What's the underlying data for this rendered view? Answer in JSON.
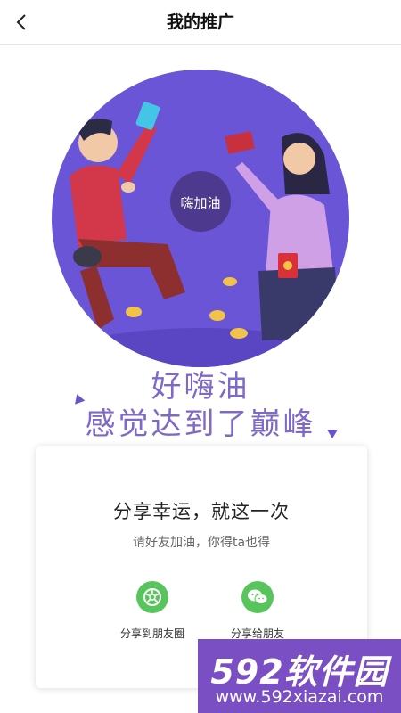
{
  "nav": {
    "back_icon": "chevron-left-icon",
    "title": "我的推广"
  },
  "hero": {
    "badge_text": "嗨加油",
    "slogan_line1": "好嗨油",
    "slogan_line2": "感觉达到了巅峰"
  },
  "share_card": {
    "title": "分享幸运，就这一次",
    "subtitle": "请好友加油，你得ta也得",
    "options": [
      {
        "label": "分享到朋友圈",
        "icon": "wechat-moments-icon"
      },
      {
        "label": "分享给朋友",
        "icon": "wechat-icon"
      }
    ]
  },
  "watermark": {
    "brand": "592软件园",
    "url": "www.592xiazai.com"
  },
  "colors": {
    "accent_purple": "#7e68c9",
    "circle_purple": "#6a55d6",
    "wechat_green": "#58c55c",
    "watermark_bg": "#7b4fc4"
  }
}
